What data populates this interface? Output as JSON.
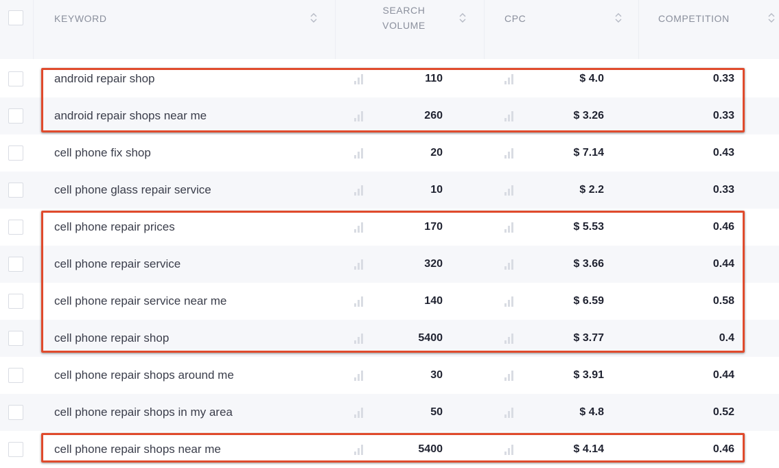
{
  "header": {
    "keyword": "KEYWORD",
    "search_volume_line1": "SEARCH",
    "search_volume_line2": "VOLUME",
    "cpc": "CPC",
    "competition": "COMPETITION"
  },
  "rows": [
    {
      "keyword": "android repair shop",
      "volume": "110",
      "cpc": "$ 4.0",
      "competition": "0.33"
    },
    {
      "keyword": "android repair shops near me",
      "volume": "260",
      "cpc": "$ 3.26",
      "competition": "0.33"
    },
    {
      "keyword": "cell phone fix shop",
      "volume": "20",
      "cpc": "$ 7.14",
      "competition": "0.43"
    },
    {
      "keyword": "cell phone glass repair service",
      "volume": "10",
      "cpc": "$ 2.2",
      "competition": "0.33"
    },
    {
      "keyword": "cell phone repair prices",
      "volume": "170",
      "cpc": "$ 5.53",
      "competition": "0.46"
    },
    {
      "keyword": "cell phone repair service",
      "volume": "320",
      "cpc": "$ 3.66",
      "competition": "0.44"
    },
    {
      "keyword": "cell phone repair service near me",
      "volume": "140",
      "cpc": "$ 6.59",
      "competition": "0.58"
    },
    {
      "keyword": "cell phone repair shop",
      "volume": "5400",
      "cpc": "$ 3.77",
      "competition": "0.4"
    },
    {
      "keyword": "cell phone repair shops around me",
      "volume": "30",
      "cpc": "$ 3.91",
      "competition": "0.44"
    },
    {
      "keyword": "cell phone repair shops in my area",
      "volume": "50",
      "cpc": "$ 4.8",
      "competition": "0.52"
    },
    {
      "keyword": "cell phone repair shops near me",
      "volume": "5400",
      "cpc": "$ 4.14",
      "competition": "0.46"
    }
  ],
  "colors": {
    "highlight": "#e04a2c",
    "row_alt": "#f6f7fa",
    "bar_icon": "#d9dce3"
  },
  "icons": {
    "sort": "sort-icon",
    "trend": "bar-chart-icon"
  }
}
